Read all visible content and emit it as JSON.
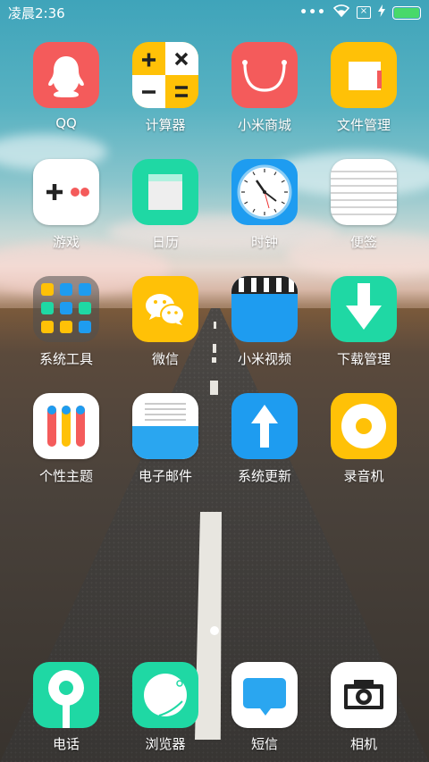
{
  "status_bar": {
    "time": "凌晨2:36",
    "dots": "•••",
    "sim_icon": "sim-x-icon",
    "battery_level": 1.0,
    "battery_color": "#48d96a"
  },
  "apps": [
    {
      "label": "QQ",
      "icon": "penguin-icon",
      "bg": "#f45b5b"
    },
    {
      "label": "计算器",
      "icon": "calculator-icon",
      "bg": "#ffc107"
    },
    {
      "label": "小米商城",
      "icon": "shopping-bag-icon",
      "bg": "#f45b5b"
    },
    {
      "label": "文件管理",
      "icon": "folder-icon",
      "bg": "#ffc107"
    },
    {
      "label": "游戏",
      "icon": "gamepad-icon",
      "bg": "#ffffff"
    },
    {
      "label": "日历",
      "icon": "calendar-icon",
      "bg": "#1fd8a4"
    },
    {
      "label": "时钟",
      "icon": "clock-icon",
      "bg": "#1e9cf0"
    },
    {
      "label": "便签",
      "icon": "notes-icon",
      "bg": "#ffffff"
    },
    {
      "label": "系统工具",
      "icon": "folder-tools-icon",
      "bg": "rgba(80,80,80,0.55)"
    },
    {
      "label": "微信",
      "icon": "wechat-icon",
      "bg": "#ffc107"
    },
    {
      "label": "小米视频",
      "icon": "video-icon",
      "bg": "#1e9cf0"
    },
    {
      "label": "下载管理",
      "icon": "download-icon",
      "bg": "#1fd8a4"
    },
    {
      "label": "个性主题",
      "icon": "themes-icon",
      "bg": "#ffffff"
    },
    {
      "label": "电子邮件",
      "icon": "email-icon",
      "bg": "#ffffff"
    },
    {
      "label": "系统更新",
      "icon": "update-arrow-icon",
      "bg": "#1e9cf0"
    },
    {
      "label": "录音机",
      "icon": "recorder-icon",
      "bg": "#ffc107"
    }
  ],
  "dock": [
    {
      "label": "电话",
      "icon": "phone-icon",
      "bg": "#1fd8a4"
    },
    {
      "label": "浏览器",
      "icon": "browser-icon",
      "bg": "#1fd8a4"
    },
    {
      "label": "短信",
      "icon": "message-icon",
      "bg": "#ffffff"
    },
    {
      "label": "相机",
      "icon": "camera-icon",
      "bg": "#ffffff"
    }
  ],
  "pager": {
    "current_page": 1,
    "total_pages": 1
  }
}
